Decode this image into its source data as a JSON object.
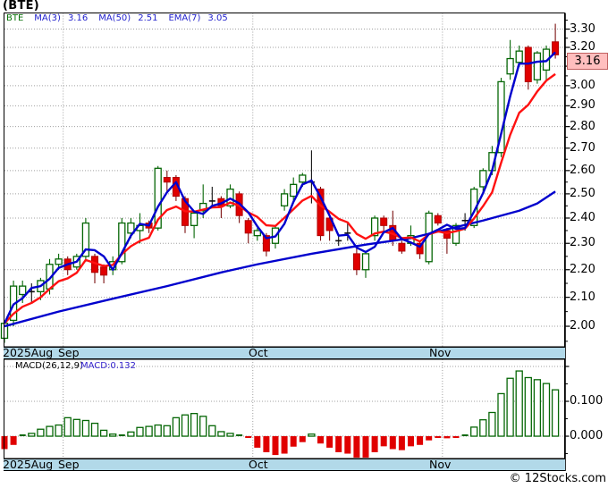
{
  "title": "(BTE)",
  "attribution": "© 12Stocks.com",
  "legend": {
    "symbol": "BTE",
    "items": [
      {
        "label": "MA(3)",
        "value": "3.16"
      },
      {
        "label": "MA(50)",
        "value": "2.51"
      },
      {
        "label": "EMA(7)",
        "value": "3.05"
      }
    ]
  },
  "macd_legend": {
    "label": "MACD(26,12,9)",
    "value": "MACD:0.132"
  },
  "price_box": {
    "value": "3.16"
  },
  "month_axis": {
    "labels": [
      {
        "text": "2025Aug"
      },
      {
        "text": "Sep"
      },
      {
        "text": "Oct"
      },
      {
        "text": "Nov"
      }
    ]
  },
  "colors": {
    "up_candle": "#056605",
    "down_candle": "#e00000",
    "down_wick": "#7b1010",
    "doji": "#101010",
    "ma_blue": "#0000cd",
    "ema_red": "#ff1111",
    "grid": "#a0a0a0",
    "strip_bg": "#b2d9e9",
    "price_box_bg": "#ffbebe"
  },
  "chart_data": [
    {
      "type": "candlestick",
      "title": "BTE daily price with MA(3), MA(50), EMA(7)",
      "yscale": "log",
      "ylim": [
        1.932,
        3.391
      ],
      "y_ticks": [
        3.3,
        3.2,
        3.1,
        3.0,
        2.9,
        2.8,
        2.7,
        2.6,
        2.5,
        2.4,
        2.3,
        2.2,
        2.1,
        2.0
      ],
      "y_minor_step": 0.05,
      "x_axis": {
        "unit": "trading-day",
        "months": [
          {
            "label": "2025Aug",
            "start_index": 0
          },
          {
            "label": "Sep",
            "start_index": 7
          },
          {
            "label": "Oct",
            "start_index": 28
          },
          {
            "label": "Nov",
            "start_index": 49
          }
        ]
      },
      "last_close": 3.16,
      "candles_format": [
        "open",
        "high",
        "low",
        "close"
      ],
      "candles": [
        [
          1.96,
          2.02,
          1.945,
          2.01
        ],
        [
          2.02,
          2.16,
          2.0,
          2.14
        ],
        [
          2.11,
          2.16,
          2.08,
          2.14
        ],
        [
          2.12,
          2.15,
          2.08,
          2.12
        ],
        [
          2.12,
          2.17,
          2.09,
          2.16
        ],
        [
          2.13,
          2.24,
          2.11,
          2.22
        ],
        [
          2.22,
          2.26,
          2.2,
          2.24
        ],
        [
          2.24,
          2.25,
          2.18,
          2.2
        ],
        [
          2.21,
          2.26,
          2.2,
          2.25
        ],
        [
          2.25,
          2.4,
          2.23,
          2.38
        ],
        [
          2.25,
          2.26,
          2.15,
          2.19
        ],
        [
          2.21,
          2.22,
          2.15,
          2.18
        ],
        [
          2.2,
          2.25,
          2.18,
          2.23
        ],
        [
          2.23,
          2.4,
          2.22,
          2.38
        ],
        [
          2.34,
          2.4,
          2.32,
          2.38
        ],
        [
          2.35,
          2.42,
          2.3,
          2.37
        ],
        [
          2.38,
          2.39,
          2.34,
          2.36
        ],
        [
          2.36,
          2.62,
          2.35,
          2.61
        ],
        [
          2.57,
          2.6,
          2.51,
          2.55
        ],
        [
          2.57,
          2.58,
          2.47,
          2.49
        ],
        [
          2.48,
          2.49,
          2.34,
          2.37
        ],
        [
          2.37,
          2.43,
          2.32,
          2.42
        ],
        [
          2.43,
          2.54,
          2.4,
          2.46
        ],
        [
          2.47,
          2.53,
          2.44,
          2.47
        ],
        [
          2.48,
          2.49,
          2.4,
          2.45
        ],
        [
          2.45,
          2.54,
          2.44,
          2.52
        ],
        [
          2.5,
          2.51,
          2.38,
          2.41
        ],
        [
          2.39,
          2.4,
          2.3,
          2.34
        ],
        [
          2.33,
          2.36,
          2.31,
          2.35
        ],
        [
          2.33,
          2.34,
          2.25,
          2.27
        ],
        [
          2.3,
          2.37,
          2.28,
          2.36
        ],
        [
          2.45,
          2.52,
          2.43,
          2.5
        ],
        [
          2.49,
          2.57,
          2.47,
          2.54
        ],
        [
          2.55,
          2.59,
          2.53,
          2.58
        ],
        [
          2.55,
          2.69,
          2.46,
          2.55
        ],
        [
          2.52,
          2.53,
          2.31,
          2.33
        ],
        [
          2.4,
          2.41,
          2.31,
          2.35
        ],
        [
          2.31,
          2.33,
          2.29,
          2.31
        ],
        [
          2.34,
          2.38,
          2.31,
          2.34
        ],
        [
          2.26,
          2.28,
          2.18,
          2.2
        ],
        [
          2.2,
          2.27,
          2.17,
          2.26
        ],
        [
          2.33,
          2.41,
          2.31,
          2.4
        ],
        [
          2.4,
          2.41,
          2.35,
          2.37
        ],
        [
          2.37,
          2.43,
          2.29,
          2.31
        ],
        [
          2.3,
          2.31,
          2.26,
          2.27
        ],
        [
          2.3,
          2.37,
          2.29,
          2.33
        ],
        [
          2.3,
          2.31,
          2.24,
          2.26
        ],
        [
          2.23,
          2.43,
          2.22,
          2.42
        ],
        [
          2.41,
          2.42,
          2.37,
          2.38
        ],
        [
          2.35,
          2.36,
          2.26,
          2.32
        ],
        [
          2.3,
          2.38,
          2.29,
          2.37
        ],
        [
          2.39,
          2.42,
          2.35,
          2.39
        ],
        [
          2.37,
          2.53,
          2.36,
          2.52
        ],
        [
          2.53,
          2.61,
          2.51,
          2.6
        ],
        [
          2.6,
          2.71,
          2.58,
          2.68
        ],
        [
          2.68,
          3.04,
          2.66,
          3.02
        ],
        [
          3.06,
          3.24,
          3.03,
          3.14
        ],
        [
          3.12,
          3.21,
          3.1,
          3.18
        ],
        [
          3.2,
          3.21,
          2.98,
          3.02
        ],
        [
          3.03,
          3.18,
          3.01,
          3.17
        ],
        [
          3.08,
          3.21,
          3.03,
          3.19
        ],
        [
          3.23,
          3.33,
          3.14,
          3.16
        ]
      ],
      "overlays": {
        "ma3": {
          "label": "MA(3)",
          "period": 3,
          "last": 3.16,
          "color": "#0000cd"
        },
        "ema7": {
          "label": "EMA(7)",
          "period": 7,
          "last": 3.05,
          "color": "#ff1111"
        },
        "ma50": {
          "label": "MA(50)",
          "period": 50,
          "last": 2.51,
          "color": "#0000cd",
          "points": [
            [
              0,
              2.0
            ],
            [
              6,
              2.05
            ],
            [
              12,
              2.095
            ],
            [
              18,
              2.14
            ],
            [
              24,
              2.19
            ],
            [
              28,
              2.22
            ],
            [
              34,
              2.26
            ],
            [
              40,
              2.295
            ],
            [
              45,
              2.32
            ],
            [
              49,
              2.355
            ],
            [
              53,
              2.39
            ],
            [
              57,
              2.43
            ],
            [
              59,
              2.46
            ],
            [
              61,
              2.51
            ]
          ]
        }
      }
    },
    {
      "type": "bar",
      "title": "MACD(26,12,9) histogram",
      "ylim": [
        -0.064,
        0.2205
      ],
      "y_gridlines": [
        0.2,
        0.1,
        0.0
      ],
      "y_minor_ticks": [
        0.15,
        0.05,
        -0.05
      ],
      "y_tick_labels": [
        0.1,
        0.0
      ],
      "last_value": 0.132,
      "values": [
        -0.037,
        -0.025,
        0.003,
        0.008,
        0.02,
        0.028,
        0.032,
        0.053,
        0.048,
        0.045,
        0.037,
        0.017,
        0.006,
        0.005,
        0.012,
        0.025,
        0.028,
        0.032,
        0.03,
        0.053,
        0.061,
        0.065,
        0.057,
        0.03,
        0.013,
        0.008,
        0.005,
        -0.004,
        -0.033,
        -0.046,
        -0.054,
        -0.05,
        -0.03,
        -0.017,
        0.006,
        -0.021,
        -0.033,
        -0.046,
        -0.05,
        -0.066,
        -0.066,
        -0.046,
        -0.029,
        -0.037,
        -0.04,
        -0.029,
        -0.025,
        -0.012,
        -0.005,
        -0.006,
        -0.004,
        0.002,
        0.026,
        0.047,
        0.068,
        0.122,
        0.166,
        0.187,
        0.168,
        0.162,
        0.151,
        0.133
      ]
    }
  ]
}
